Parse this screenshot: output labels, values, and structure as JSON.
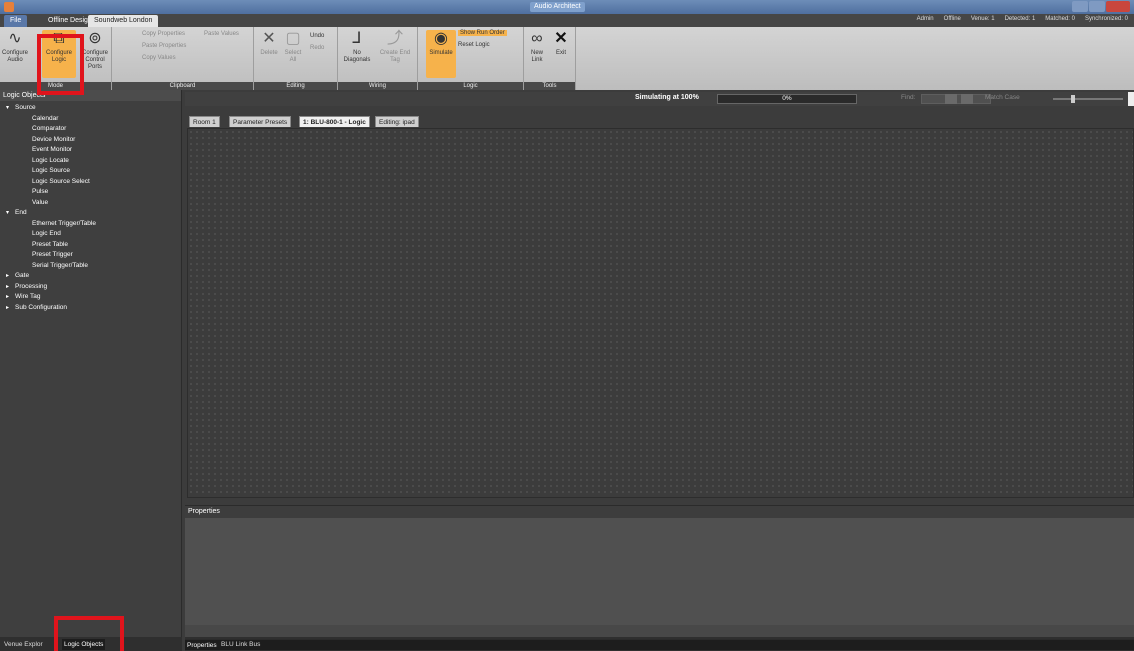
{
  "window": {
    "title": "Audio Architect"
  },
  "tabs": {
    "file": "File",
    "offline": "Offline Design",
    "soundweb": "Soundweb London"
  },
  "status": [
    "Admin",
    "Offline",
    "Venue: 1",
    "Detected: 1",
    "Matched: 0",
    "Synchronized: 0"
  ],
  "ribbon": {
    "mode": {
      "label": "Mode",
      "configure_audio": "Configure Audio",
      "configure_logic": "Configure Logic",
      "configure_control_ports": "Configure Control Ports"
    },
    "clipboard": {
      "label": "Clipboard",
      "copy_properties": "Copy Properties",
      "paste_values": "Paste Values",
      "paste_properties": "Paste Properties",
      "copy_values": "Copy Values"
    },
    "editing": {
      "label": "Editing",
      "delete": "Delete",
      "select_all": "Select All",
      "undo": "Undo",
      "redo": "Redo"
    },
    "wiring": {
      "label": "Wiring",
      "no_diagonals": "No Diagonals",
      "create_end_tag": "Create End Tag"
    },
    "logic": {
      "label": "Logic",
      "simulate": "Simulate",
      "show_run_order": "Show Run Order",
      "reset_logic": "Reset Logic"
    },
    "tools": {
      "label": "Tools",
      "new_link": "New Link",
      "exit": "Exit"
    }
  },
  "left_panel": {
    "title": "Logic Objects",
    "tree": [
      {
        "label": "Source",
        "type": "cat",
        "expanded": true
      },
      {
        "label": "Calendar",
        "type": "child"
      },
      {
        "label": "Comparator",
        "type": "child"
      },
      {
        "label": "Device Monitor",
        "type": "child"
      },
      {
        "label": "Event Monitor",
        "type": "child"
      },
      {
        "label": "Logic Locate",
        "type": "child"
      },
      {
        "label": "Logic Source",
        "type": "child"
      },
      {
        "label": "Logic Source Select",
        "type": "child"
      },
      {
        "label": "Pulse",
        "type": "child"
      },
      {
        "label": "Value",
        "type": "child"
      },
      {
        "label": "End",
        "type": "cat",
        "expanded": true
      },
      {
        "label": "Ethernet Trigger/Table",
        "type": "child"
      },
      {
        "label": "Logic End",
        "type": "child"
      },
      {
        "label": "Preset Table",
        "type": "child"
      },
      {
        "label": "Preset Trigger",
        "type": "child"
      },
      {
        "label": "Serial Trigger/Table",
        "type": "child"
      },
      {
        "label": "Gate",
        "type": "cat",
        "expanded": false
      },
      {
        "label": "Processing",
        "type": "cat",
        "expanded": false
      },
      {
        "label": "Wire Tag",
        "type": "cat",
        "expanded": false
      },
      {
        "label": "Sub Configuration",
        "type": "cat",
        "expanded": false
      }
    ],
    "bottom_tabs": {
      "venue": "Venue Explor",
      "logic": "Logic Objects"
    }
  },
  "simbar": {
    "label": "Simulating at 100%",
    "progress": "0%",
    "find": "Find:",
    "match_case": "Match Case"
  },
  "doc_tabs": [
    "Room 1",
    "Parameter Presets",
    "1: BLU-800-1 - Logic",
    "Editing: ipad"
  ],
  "properties": {
    "title": "Properties",
    "tab_properties": "Properties",
    "tab_blu": "BLU Link Bus"
  },
  "colors": {
    "highlight": "#e0141c",
    "active_button": "#f6b24b",
    "title_bar": "#5a78a8"
  }
}
